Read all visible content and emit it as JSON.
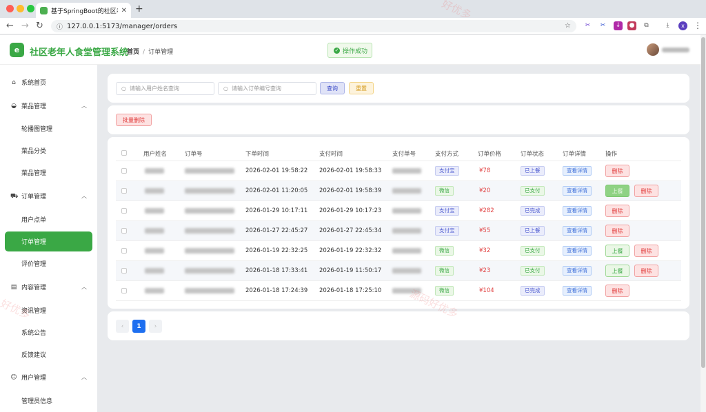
{
  "browser": {
    "tab_title": "基于SpringBoot的社区老年人食",
    "url": "127.0.0.1:5173/manager/orders",
    "profile_initial": "x"
  },
  "header": {
    "app_title": "社区老年人食堂管理系统",
    "breadcrumb_home": "首页",
    "breadcrumb_sep": "/",
    "breadcrumb_current": "订单管理",
    "toast": "操作成功"
  },
  "sidebar": {
    "home": "系统首页",
    "dish_group": "菜品管理",
    "dish_items": [
      "轮播图管理",
      "菜品分类",
      "菜品管理"
    ],
    "order_group": "订单管理",
    "order_items": [
      "用户点单",
      "订单管理",
      "评价管理"
    ],
    "content_group": "内容管理",
    "content_items": [
      "资讯管理",
      "系统公告",
      "反馈建议"
    ],
    "user_group": "用户管理",
    "user_items": [
      "管理员信息"
    ]
  },
  "search": {
    "user_placeholder": "请输入用户姓名查询",
    "order_placeholder": "请输入订单编号查询",
    "query_label": "查询",
    "reset_label": "重置"
  },
  "batch_delete_label": "批量删除",
  "table": {
    "headers": [
      "用户姓名",
      "订单号",
      "下单时间",
      "支付时间",
      "支付单号",
      "支付方式",
      "订单价格",
      "订单状态",
      "订单详情",
      "操作"
    ],
    "detail_label": "查看详情",
    "delete_label": "删除",
    "serve_label": "上餐",
    "rows": [
      {
        "order_time": "2026-02-01 19:58:22",
        "pay_time": "2026-02-01 19:58:33",
        "pay_method": "支付宝",
        "price": "¥78",
        "status": "已上餐",
        "actions": [
          "删除"
        ]
      },
      {
        "order_time": "2026-02-01 11:20:05",
        "pay_time": "2026-02-01 19:58:39",
        "pay_method": "微信",
        "price": "¥20",
        "status": "已支付",
        "actions": [
          "上餐",
          "删除"
        ]
      },
      {
        "order_time": "2026-01-29 10:17:11",
        "pay_time": "2026-01-29 10:17:23",
        "pay_method": "支付宝",
        "price": "¥282",
        "status": "已完成",
        "actions": [
          "删除"
        ]
      },
      {
        "order_time": "2026-01-27 22:45:27",
        "pay_time": "2026-01-27 22:45:34",
        "pay_method": "支付宝",
        "price": "¥55",
        "status": "已上餐",
        "actions": [
          "删除"
        ]
      },
      {
        "order_time": "2026-01-19 22:32:25",
        "pay_time": "2026-01-19 22:32:32",
        "pay_method": "微信",
        "price": "¥32",
        "status": "已支付",
        "actions": [
          "上餐",
          "删除"
        ]
      },
      {
        "order_time": "2026-01-18 17:33:41",
        "pay_time": "2026-01-19 11:50:17",
        "pay_method": "微信",
        "price": "¥23",
        "status": "已支付",
        "actions": [
          "上餐",
          "删除"
        ]
      },
      {
        "order_time": "2026-01-18 17:24:39",
        "pay_time": "2026-01-18 17:25:10",
        "pay_method": "微信",
        "price": "¥104",
        "status": "已完成",
        "actions": [
          "删除"
        ]
      }
    ]
  },
  "pagination": {
    "prev": "‹",
    "current": "1",
    "next": "›"
  },
  "watermark": [
    "好优多",
    "源码好优多",
    "好优多"
  ]
}
